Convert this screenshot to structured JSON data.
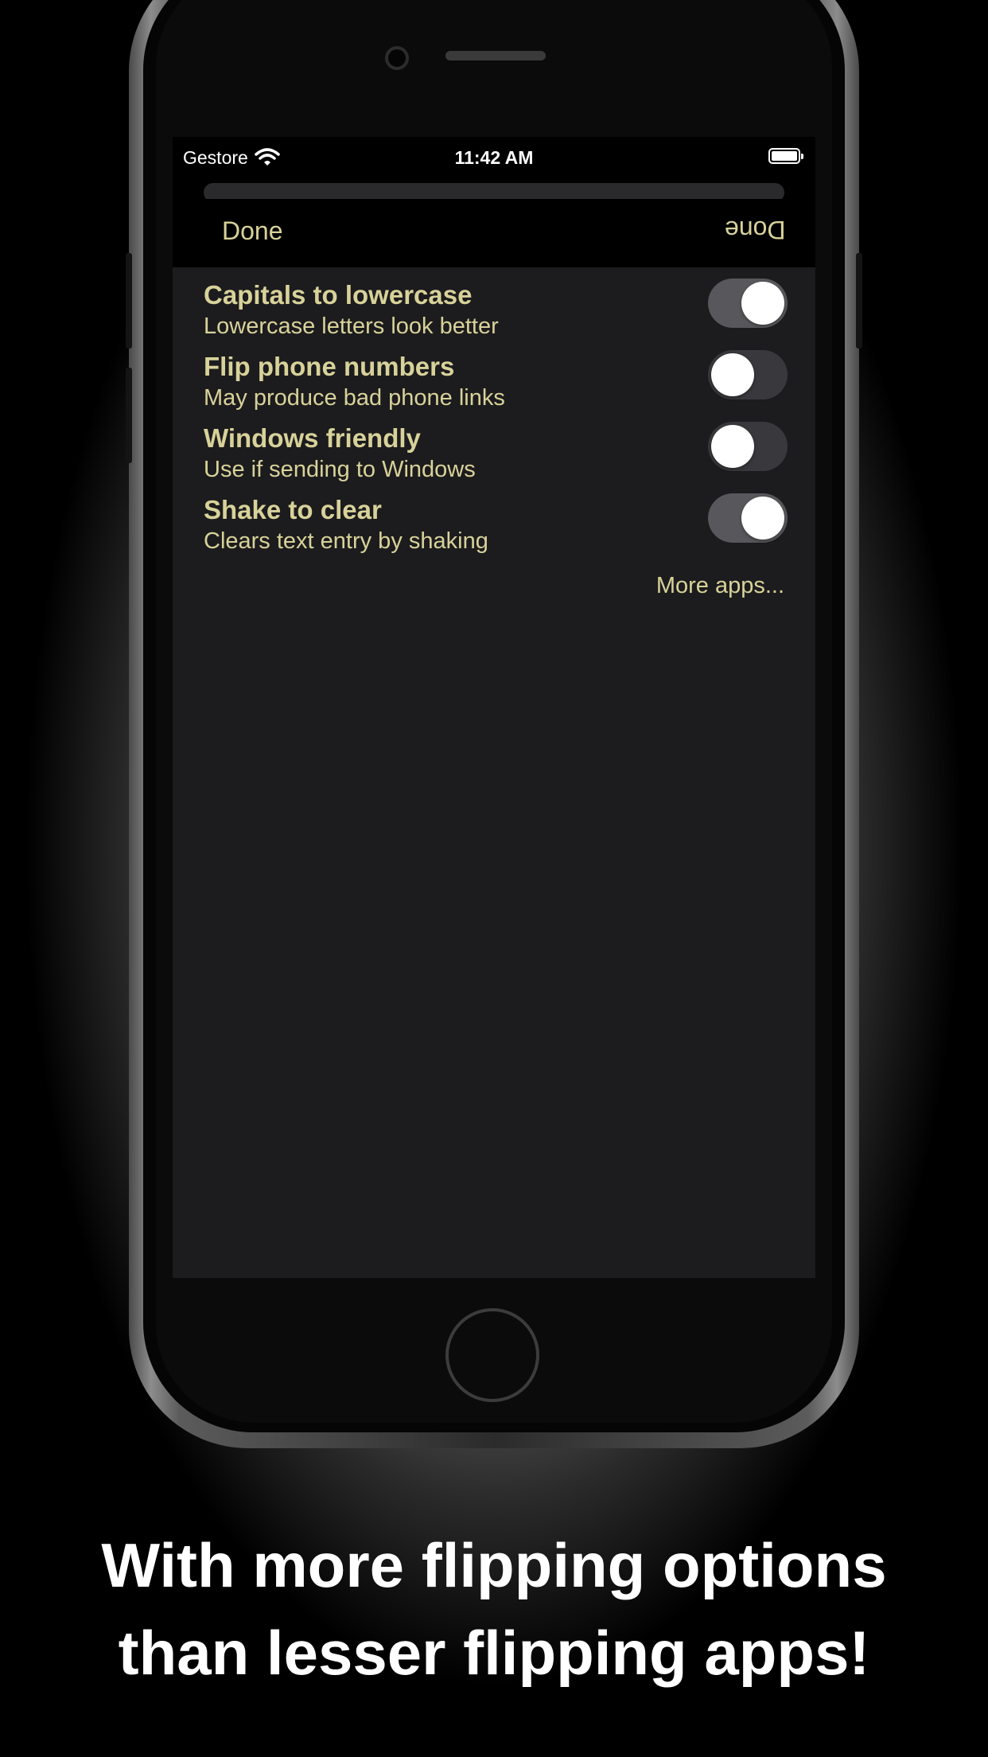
{
  "status_bar": {
    "carrier": "Gestore",
    "time": "11:42 AM"
  },
  "nav": {
    "done_label": "Done",
    "done_flipped_label": "Done"
  },
  "settings": [
    {
      "title": "Capitals to lowercase",
      "subtitle": "Lowercase letters look better",
      "enabled": true
    },
    {
      "title": "Flip phone numbers",
      "subtitle": "May produce bad phone links",
      "enabled": false
    },
    {
      "title": "Windows friendly",
      "subtitle": "Use if sending to Windows",
      "enabled": false
    },
    {
      "title": "Shake to clear",
      "subtitle": "Clears text entry by shaking",
      "enabled": true
    }
  ],
  "more_apps_label": "More apps...",
  "caption": {
    "line1": "With more flipping options",
    "line2": "than lesser flipping apps!"
  },
  "colors": {
    "accent_text": "#d8d29a",
    "screen_bg": "#1c1c1e",
    "bar_bg": "#000000"
  }
}
